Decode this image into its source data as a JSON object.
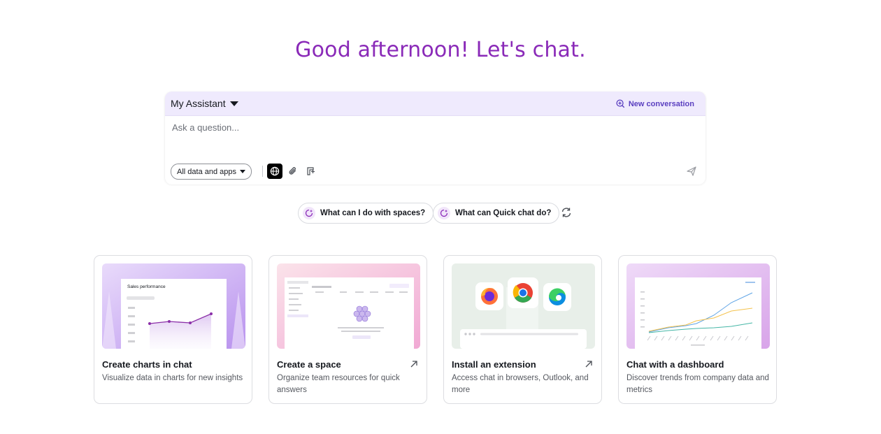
{
  "greeting": "Good afternoon! Let's chat.",
  "composer": {
    "assistant_label": "My Assistant",
    "new_conversation_label": "New conversation",
    "input_placeholder": "Ask a question...",
    "input_value": "",
    "scope_label": "All data and apps"
  },
  "suggestions": {
    "items": [
      "What can I do with spaces?",
      "What can Quick chat do?"
    ]
  },
  "cards": [
    {
      "title": "Create charts in chat",
      "description": "Visualize data in charts for new insights",
      "thumb_title": "Sales performance"
    },
    {
      "title": "Create a space",
      "description": "Organize team resources for quick answers"
    },
    {
      "title": "Install an extension",
      "description": "Access chat in browsers, Outlook, and more"
    },
    {
      "title": "Chat with a dashboard",
      "description": "Discover trends from company data and metrics"
    }
  ],
  "colors": {
    "accent": "#8a2ab8",
    "link": "#5a3fc0",
    "composer_bg": "#efeafd"
  },
  "icons": [
    "new-conversation-icon",
    "globe-icon",
    "paperclip-icon",
    "prompt-icon",
    "send-icon",
    "sparkle-chat-icon",
    "refresh-icon",
    "external-link-icon"
  ]
}
